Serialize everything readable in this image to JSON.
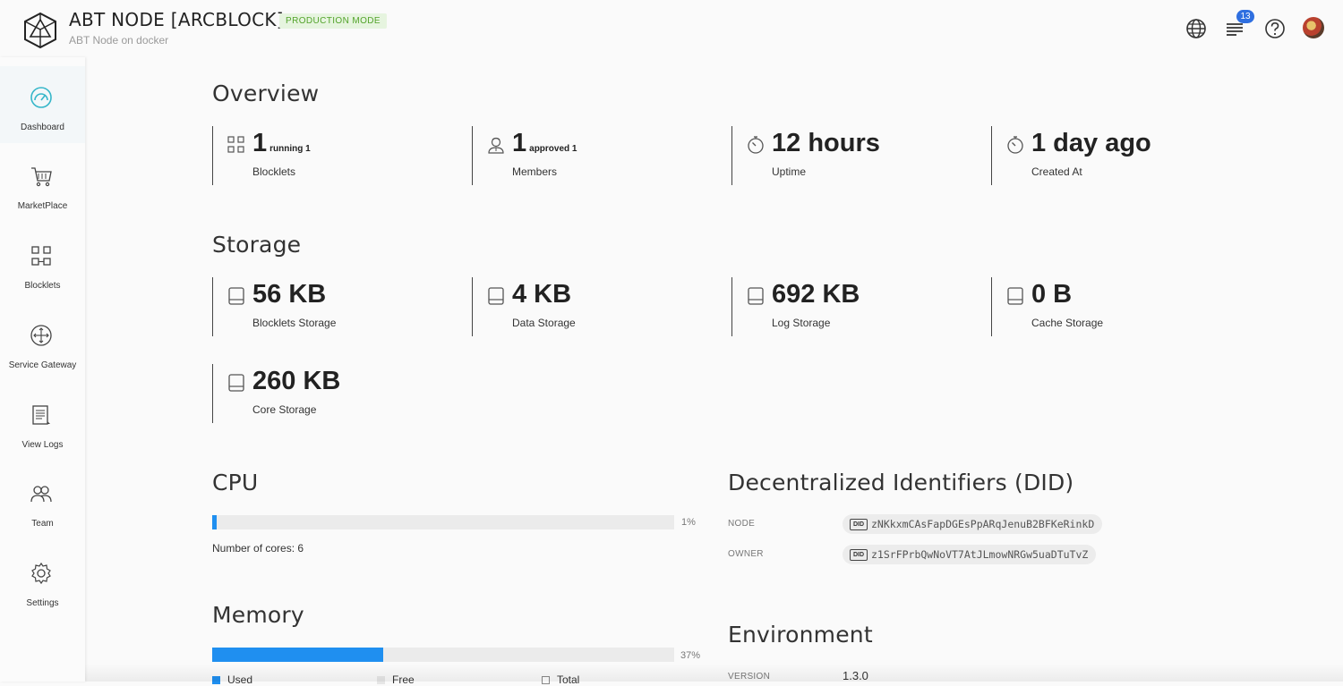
{
  "header": {
    "title": "ABT NODE [ARCBLOCK]",
    "mode_badge": "PRODUCTION MODE",
    "subtitle": "ABT Node on docker",
    "notification_count": "13"
  },
  "sidebar": {
    "items": [
      {
        "label": "Dashboard",
        "icon": "dashboard-gauge-icon",
        "active": true
      },
      {
        "label": "MarketPlace",
        "icon": "cart-icon"
      },
      {
        "label": "Blocklets",
        "icon": "blocklets-grid-icon"
      },
      {
        "label": "Service Gateway",
        "icon": "gateway-compass-icon"
      },
      {
        "label": "View Logs",
        "icon": "logs-document-icon"
      },
      {
        "label": "Team",
        "icon": "team-people-icon"
      },
      {
        "label": "Settings",
        "icon": "gear-icon"
      }
    ]
  },
  "overview": {
    "title": "Overview",
    "stats": [
      {
        "value": "1",
        "suffix": "running 1",
        "caption": "Blocklets",
        "icon": "blocklets-grid-icon"
      },
      {
        "value": "1",
        "suffix": "approved 1",
        "caption": "Members",
        "icon": "members-icon"
      },
      {
        "value": "12 hours",
        "suffix": "",
        "caption": "Uptime",
        "icon": "stopwatch-icon"
      },
      {
        "value": "1 day ago",
        "suffix": "",
        "caption": "Created At",
        "icon": "stopwatch-icon"
      }
    ]
  },
  "storage": {
    "title": "Storage",
    "stats": [
      {
        "value": "56 KB",
        "caption": "Blocklets Storage",
        "icon": "disk-icon"
      },
      {
        "value": "4 KB",
        "caption": "Data Storage",
        "icon": "disk-icon"
      },
      {
        "value": "692 KB",
        "caption": "Log Storage",
        "icon": "disk-icon"
      },
      {
        "value": "0 B",
        "caption": "Cache Storage",
        "icon": "disk-icon"
      },
      {
        "value": "260 KB",
        "caption": "Core Storage",
        "icon": "disk-icon"
      }
    ]
  },
  "cpu": {
    "title": "CPU",
    "usage_percent": 1,
    "usage_label": "1%",
    "cores_text": "Number of cores: 6"
  },
  "memory": {
    "title": "Memory",
    "usage_percent": 37,
    "usage_label": "37%",
    "legend": [
      "Used",
      "Free",
      "Total"
    ]
  },
  "did": {
    "title": "Decentralized Identifiers (DID)",
    "rows": [
      {
        "label": "NODE",
        "value": "zNKkxmCAsFapDGEsPpARqJenuB2BFKeRinkD"
      },
      {
        "label": "OWNER",
        "value": "z1SrFPrbQwNoVT7AtJLmowNRGw5uaDTuTvZ"
      }
    ],
    "chip_icon_text": "DID"
  },
  "environment": {
    "title": "Environment",
    "version_label": "VERSION",
    "version_value": "1.3.0"
  },
  "colors": {
    "accent": "#1f8ff0",
    "badge_bg": "#e6f4df",
    "badge_text": "#52a32a",
    "notification": "#2f6fe0"
  }
}
